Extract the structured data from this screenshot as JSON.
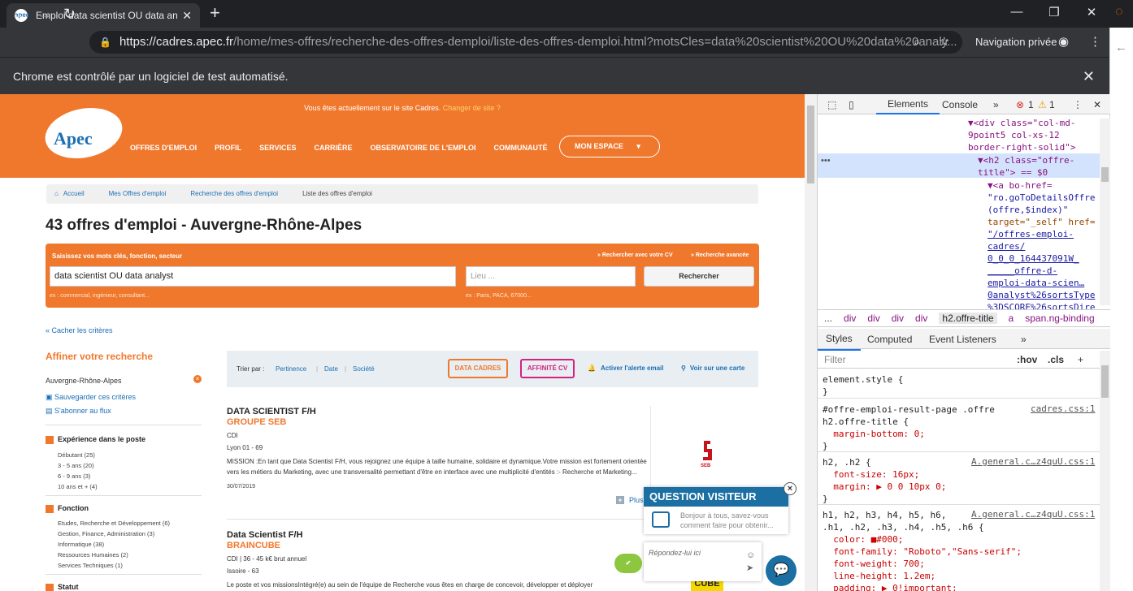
{
  "browser": {
    "tab_title": "Emploi data scientist OU data ana",
    "url_host": "https://cadres.apec.fr",
    "url_path": "/home/mes-offres/recherche-des-offres-demploi/liste-des-offres-demploi.html?motsCles=data%20scientist%20OU%20data%20analy...",
    "private_label": "Navigation privée",
    "infobar": "Chrome est contrôlé par un logiciel de test automatisé."
  },
  "site": {
    "notice": "Vous êtes actuellement sur le site Cadres.",
    "change_link": "Changer de site ?",
    "logo": "Apec",
    "menu": [
      "OFFRES D'EMPLOI",
      "PROFIL",
      "SERVICES",
      "CARRIÈRE",
      "OBSERVATOIRE DE L'EMPLOI",
      "COMMUNAUTÉ"
    ],
    "mon_espace": "MON ESPACE",
    "breadcrumb": [
      "Accueil",
      "Mes Offres d'emploi",
      "Recherche des offres d'emploi",
      "Liste des offres d'emploi"
    ],
    "page_title": "43 offres d'emploi - Auvergne-Rhône-Alpes"
  },
  "search": {
    "label": "Saisissez vos mots clés, fonction, secteur",
    "cv_link": "» Rechercher avec votre CV",
    "advanced_link": "» Recherche avancée",
    "keywords_value": "data scientist OU data analyst",
    "location_placeholder": "Lieu ...",
    "button": "Rechercher",
    "example_keywords": "ex : commercial, ingénieur, consultant...",
    "example_location": "ex : Paris, PACA, 67000..."
  },
  "filters": {
    "hide_criteria": "« Cacher les critères",
    "title": "Affiner votre recherche",
    "location": "Auvergne-Rhône-Alpes",
    "save": "Sauvegarder ces critères",
    "subscribe": "S'abonner au flux",
    "experience_title": "Expérience dans le poste",
    "experience": [
      "Débutant (25)",
      "3 - 5 ans  (20)",
      "6 - 9 ans (3)",
      "10 ans et + (4)"
    ],
    "fonction_title": "Fonction",
    "fonction": [
      "Etudes, Recherche et Développement (6)",
      "Gestion, Finance, Administration (3)",
      "Informatique (38)",
      "Ressources Humaines (2)",
      "Services Techniques (1)"
    ],
    "statut_title": "Statut"
  },
  "sort": {
    "label": "Trier par :",
    "options": [
      "Pertinence",
      "Date",
      "Société"
    ],
    "data_cadres": "DATA CADRES",
    "affinite_cv": "AFFINITÉ CV",
    "alert": "Activer l'alerte email",
    "map": "Voir sur une carte"
  },
  "jobs": [
    {
      "title": "DATA SCIENTIST F/H",
      "company": "GROUPE SEB",
      "contract": "CDI",
      "location": "Lyon 01 - 69",
      "desc": "MISSION :En tant que Data Scientist F/H, vous rejoignez une équipe à taille humaine, solidaire et dynamique.Votre mission est fortement orientée vers les métiers du Marketing, avec une transversalité permettant d'être en interface avec une multiplicité d'entités :- Recherche et Marketing...",
      "date": "30/07/2019",
      "logo": "SEB",
      "more": "Plus"
    },
    {
      "title": "Data Scientist F/H",
      "company": "BRAINCUBE",
      "contract": "CDI | 36 - 45 k€ brut annuel",
      "location": "Issoire - 63",
      "desc": "Le poste et vos missionsIntégré(e) au sein de l'équipe de Recherche vous êtes en charge de concevoir, développer et déployer",
      "logo": "CUBE"
    }
  ],
  "chat": {
    "title": "QUESTION VISITEUR",
    "text": "Bonjour à tous, savez-vous comment faire pour obtenir...",
    "reply_placeholder": "Répondez-lui ici"
  },
  "devtools": {
    "tabs": [
      "Elements",
      "Console"
    ],
    "errors": "1",
    "warnings": "1",
    "dom_lines": [
      "▼<div class=\"col-md-",
      "9point5 col-xs-12",
      "border-right-solid\">",
      "▼<h2 class=\"offre-",
      "title\"> == $0",
      "▼<a bo-href=",
      "\"ro.goToDetailsOffre",
      "(offre,$index)\"",
      "target=\"_self\" href=",
      "\"/offres-emploi-",
      "cadres/",
      "0_0_0_164437091W_",
      "_____offre-d-",
      "emploi-data-scien…",
      "0analyst%26sortsType",
      "%3DSCORE%26sortsDire"
    ],
    "crumbs": [
      "...",
      "div",
      "div",
      "div",
      "div",
      "h2.offre-title",
      "a",
      "span.ng-binding"
    ],
    "style_tabs": [
      "Styles",
      "Computed",
      "Event Listeners"
    ],
    "filter_placeholder": "Filter",
    "hov": ":hov",
    "cls": ".cls",
    "rules": [
      {
        "selector": "element.style {",
        "props": [],
        "src": ""
      },
      {
        "selector": "#offre-emploi-result-page .offre\nh2.offre-title {",
        "props": [
          "margin-bottom: 0;"
        ],
        "src": "cadres.css:1"
      },
      {
        "selector": "h2, .h2 {",
        "props": [
          "font-size: 16px;",
          "margin: ▶ 0 0 10px 0;"
        ],
        "src": "A.general.c…z4quU.css:1"
      },
      {
        "selector": "h1, h2, h3, h4, h5, h6,\n.h1, .h2, .h3, .h4, .h5, .h6 {",
        "props": [
          "color: ■#000;",
          "font-family: \"Roboto\",\"Sans-serif\";",
          "font-weight: 700;",
          "line-height: 1.2em;",
          "padding: ▶ 0!important;"
        ],
        "src": "A.general.c…z4quU.css:1"
      }
    ]
  }
}
